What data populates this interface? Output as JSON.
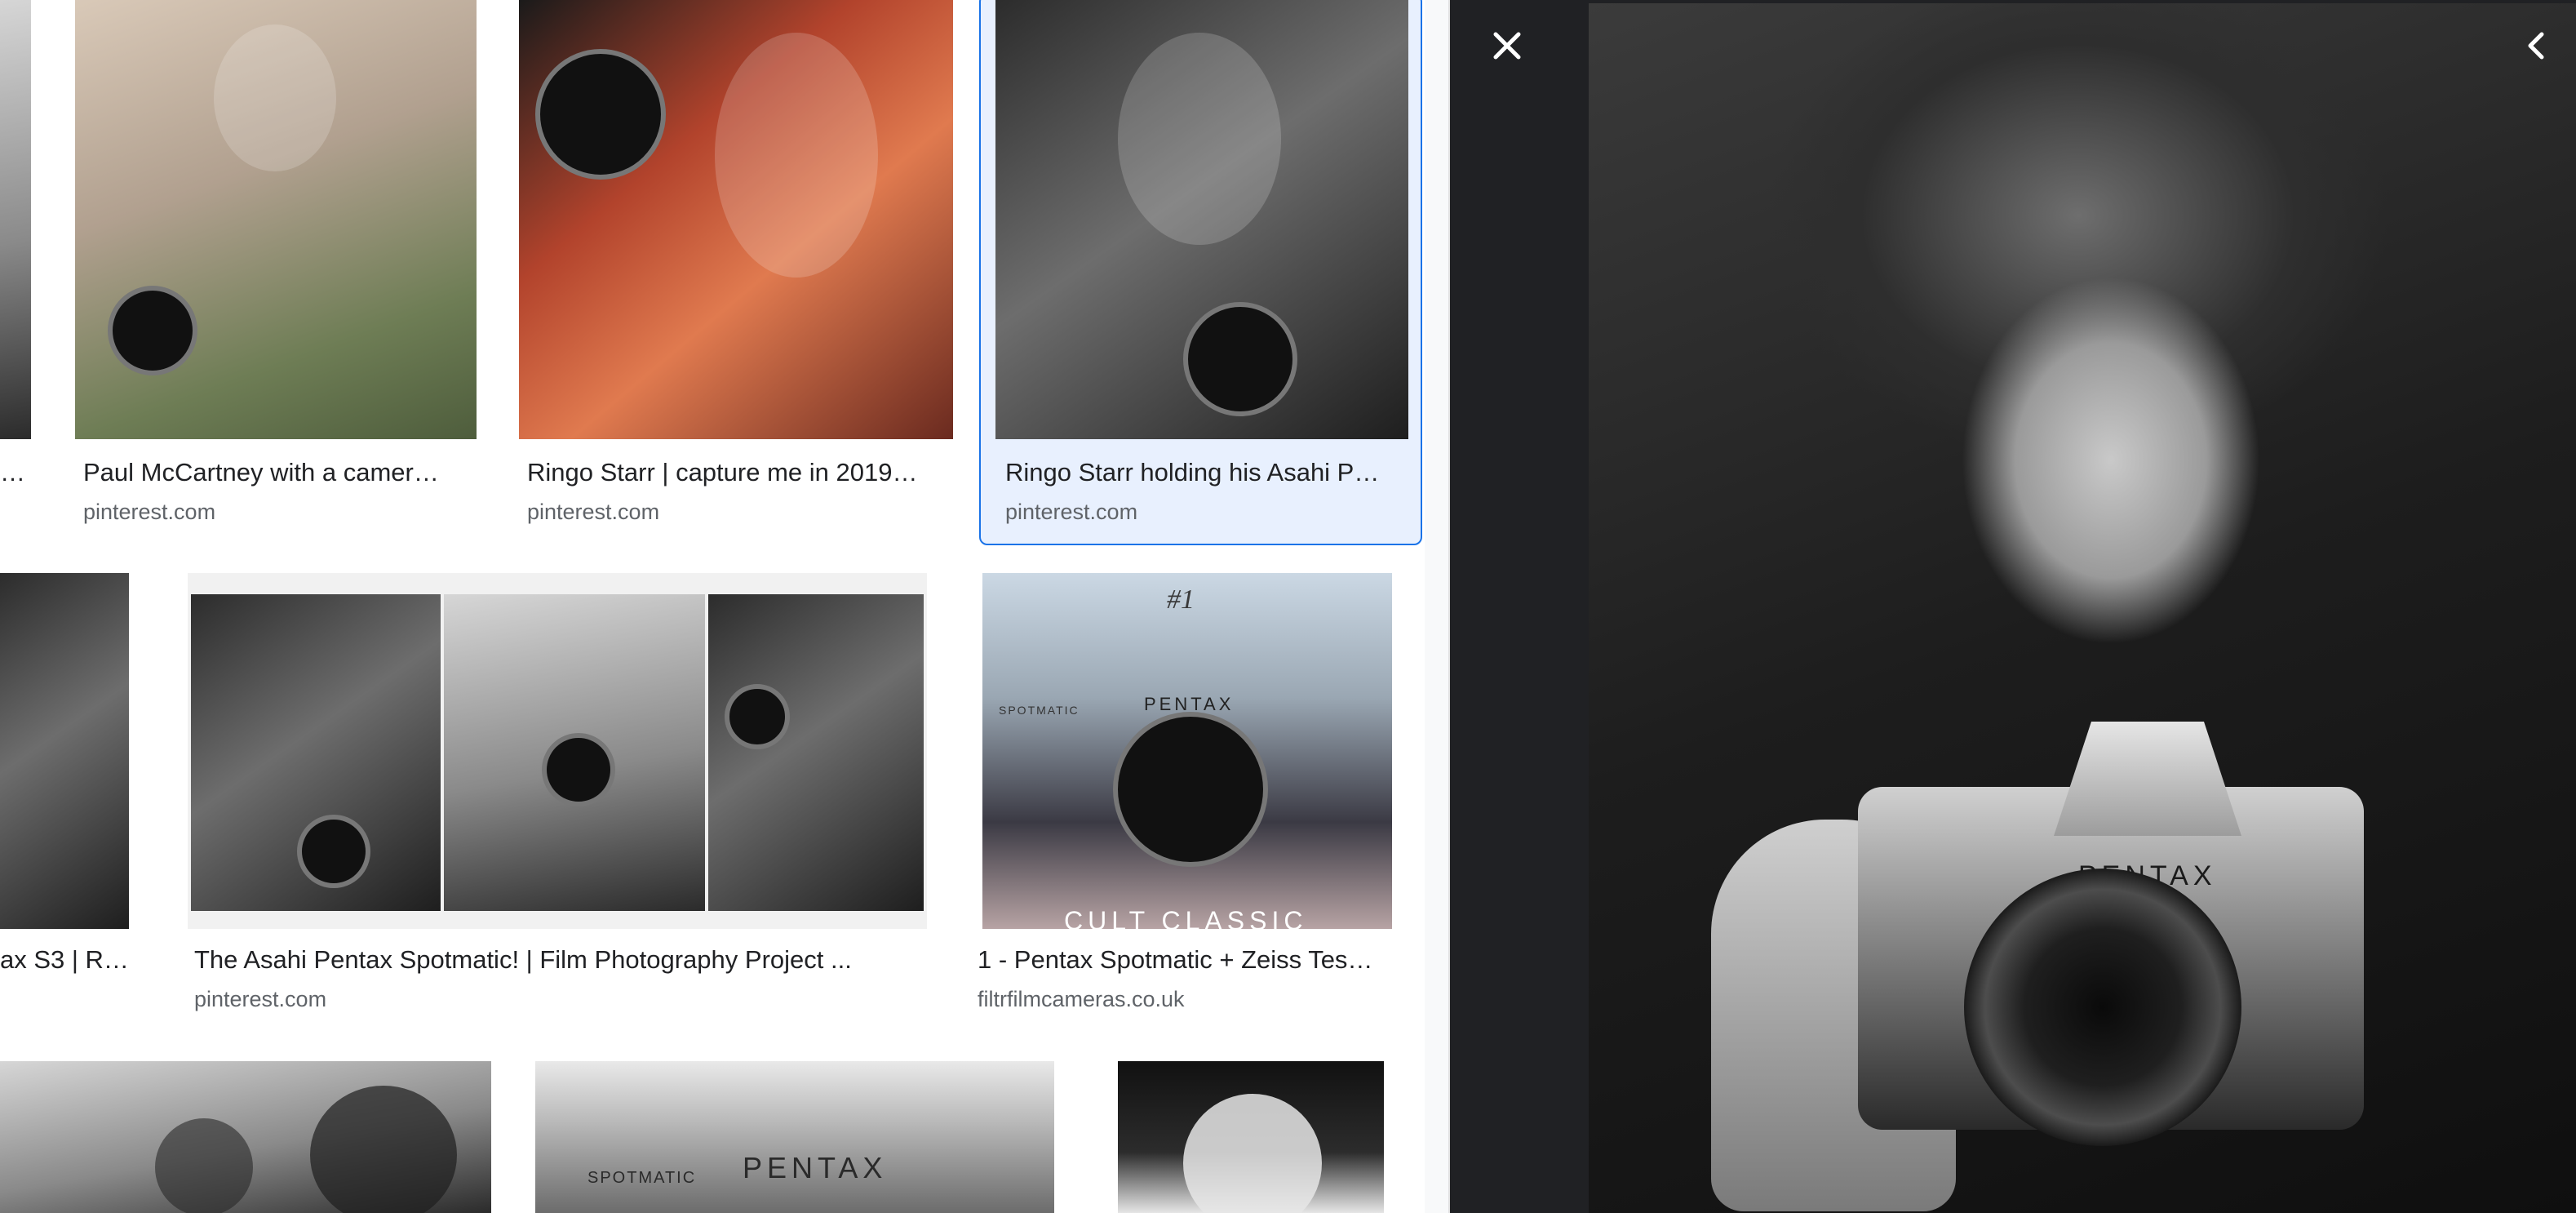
{
  "results": {
    "row1": [
      {
        "title": "…",
        "source": ""
      },
      {
        "title": "Paul McCartney with a camer…",
        "source": "pinterest.com"
      },
      {
        "title": "Ringo Starr | capture me in 2019…",
        "source": "pinterest.com"
      },
      {
        "title": "Ringo Starr holding his Asahi P…",
        "source": "pinterest.com"
      }
    ],
    "row2": [
      {
        "title": "ax S3 | R…",
        "source": ""
      },
      {
        "title": "The Asahi Pentax Spotmatic! | Film Photography Project ...",
        "source": "pinterest.com"
      },
      {
        "title": "1 - Pentax Spotmatic + Zeiss Tes…",
        "source": "filtrfilmcameras.co.uk"
      }
    ],
    "row2_thumb_text": {
      "cam_label": "#1",
      "brand": "PENTAX",
      "model": "SPOTMATIC",
      "banner": "CULT CLASSIC"
    },
    "row3_thumb_text": {
      "brand": "PENTAX",
      "model": "SPOTMATIC"
    }
  },
  "viewer": {
    "preview_brand": "PENTAX",
    "close_icon": "close-icon",
    "collapse_icon": "chevron-left-icon"
  },
  "colors": {
    "selected_border": "#1a73e8",
    "selected_bg": "#e8f0fe",
    "viewer_bg": "#202124"
  }
}
